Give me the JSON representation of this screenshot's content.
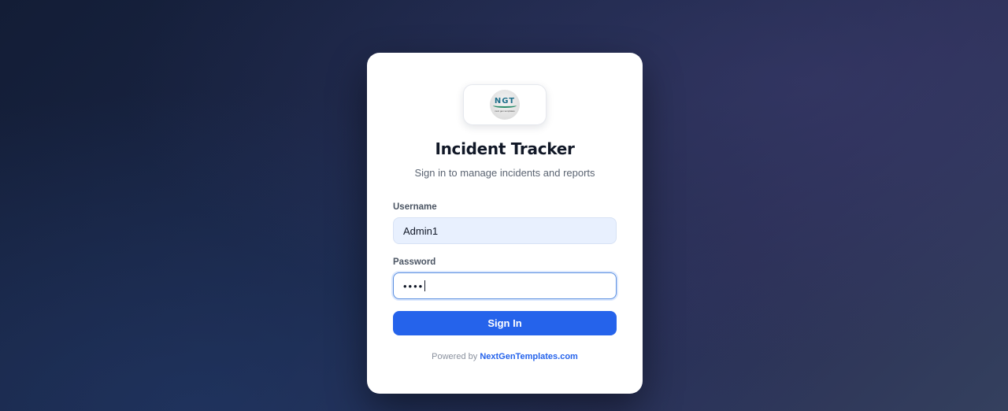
{
  "app": {
    "title": "Incident Tracker",
    "subtitle": "Sign in to manage incidents and reports"
  },
  "logo": {
    "text": "NGT",
    "tagline": "next gen templates"
  },
  "form": {
    "username_label": "Username",
    "username_value": "Admin1",
    "password_label": "Password",
    "password_masked": "••••",
    "submit_label": "Sign In"
  },
  "footer": {
    "prefix": "Powered by",
    "link_text": "NextGenTemplates.com"
  },
  "colors": {
    "accent": "#2563eb",
    "username_fill": "#e8f0fe",
    "title": "#111827"
  },
  "icons": [
    "ngt-logo"
  ]
}
